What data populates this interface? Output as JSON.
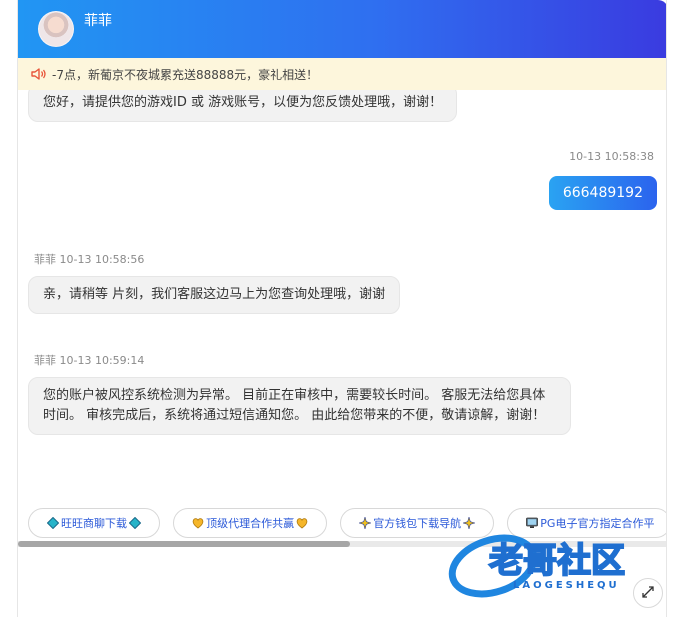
{
  "header": {
    "name": "菲菲"
  },
  "notice": {
    "text": "-7点，新葡京不夜城累充送88888元，豪礼相送！"
  },
  "messages": [
    {
      "side": "left",
      "text": "您好，请提供您的游戏ID 或 游戏账号，以便为您反馈处理哦，谢谢！"
    },
    {
      "side": "right",
      "time": "10-13 10:58:38",
      "text": "666489192"
    },
    {
      "side": "left",
      "sender_time": "菲菲 10-13 10:58:56",
      "text": "亲，请稍等 片刻，我们客服这边马上为您查询处理哦，谢谢"
    },
    {
      "side": "left",
      "sender_time": "菲菲 10-13 10:59:14",
      "text": "您的账户被风控系统检测为异常。 目前正在审核中，需要较长时间。 客服无法给您具体时间。 审核完成后，系统将通过短信通知您。 由此给您带来的不便，敬请谅解，谢谢！"
    }
  ],
  "quick_links": [
    {
      "label": "旺旺商聊下载",
      "icon": "diamond-icon"
    },
    {
      "label": "顶级代理合作共赢",
      "icon": "heart-icon"
    },
    {
      "label": "官方钱包下载导航",
      "icon": "sparkle-icon"
    },
    {
      "label": "PG电子官方指定合作平",
      "icon": "monitor-icon"
    }
  ],
  "watermark": {
    "main": "老哥社区",
    "sub": "LAOGESHEQU"
  },
  "colors": {
    "header_start": "#2196f3",
    "header_end": "#3a3be0",
    "notice_bg": "#fdf6dc",
    "link": "#2b59d8"
  }
}
